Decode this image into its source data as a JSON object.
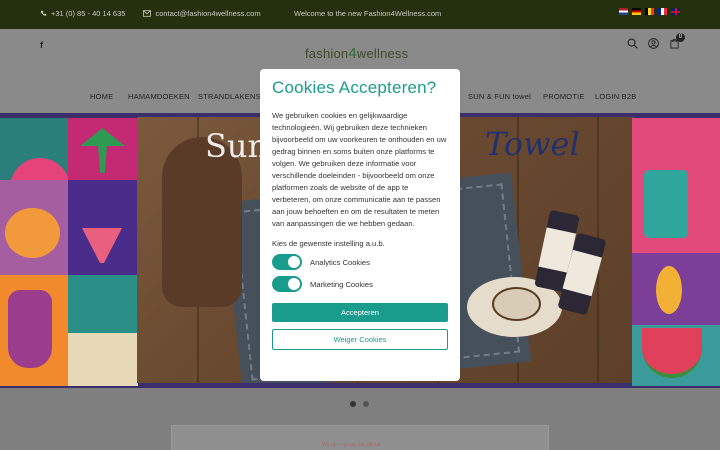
{
  "topbar": {
    "phone": "+31 (0) 85 - 40 14 635",
    "email": "contact@fashion4wellness.com",
    "welcome": "Welcome to the new Fashion4Wellness.com",
    "flags": [
      "nl",
      "de",
      "be",
      "fr",
      "gb"
    ]
  },
  "header": {
    "logo_prefix": "fashion",
    "logo_four": "4",
    "logo_suffix": "wellness",
    "cart_count": "0",
    "social_icon": "facebook-icon"
  },
  "nav": {
    "items": [
      {
        "label": "HOME"
      },
      {
        "label": "HAMAMDOEKEN"
      },
      {
        "label": "STRANDLAKENS"
      },
      {
        "label": "SUN & FUN towel"
      },
      {
        "label": "PROMOTIE"
      },
      {
        "label": "LOGIN B2B"
      }
    ]
  },
  "hero": {
    "title_left": "Sun",
    "title_right": "Towel"
  },
  "carousel": {
    "slides": 2,
    "active": 1
  },
  "below": {
    "text": "Wij zijn u graag van dienst"
  },
  "cookie_modal": {
    "title": "Cookies Accepteren?",
    "body": "We gebruiken cookies en gelijkwaardige technologieën. Wij gebruiken deze technieken bijvoorbeeld om uw voorkeuren te onthouden en uw gedrag binnen en soms buiten onze platforms te volgen. We gebruiken deze informatie voor verschillende doeleinden - bijvoorbeeld om onze platformen zoals de website of de app te verbeteren, om onze communicatie aan te passen aan jouw behoeften en om de resultaten te meten van aanpassingen die we hebben gedaan.",
    "prompt": "Kies de gewenste instelling a.u.b.",
    "toggles": [
      {
        "label": "Analytics Cookies",
        "checked": true
      },
      {
        "label": "Marketing Cookies",
        "checked": true
      }
    ],
    "accept_label": "Accepteren",
    "decline_label": "Weiger Cookies",
    "accent": "#1a9c8c"
  }
}
